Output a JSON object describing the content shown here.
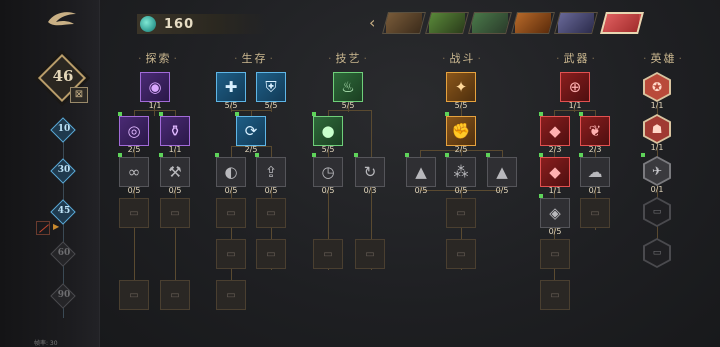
{
  "player": {
    "level": "46"
  },
  "currency": {
    "value": "160",
    "icon": "crystal-icon",
    "color": "#5fd2c0"
  },
  "milestones": [
    {
      "label": "10",
      "reached": true
    },
    {
      "label": "30",
      "reached": true
    },
    {
      "label": "45",
      "reached": true
    },
    {
      "label": "60",
      "reached": false
    },
    {
      "label": "90",
      "reached": false
    }
  ],
  "footer": {
    "text": "帧率: 30"
  },
  "categories": {
    "explore": "探索",
    "survive": "生存",
    "skill": "技艺",
    "combat": "战斗",
    "weapon": "武器",
    "hero": "英雄"
  },
  "characters": [
    {
      "name": "raccoon",
      "color": "#7a5c3a"
    },
    {
      "name": "turtle",
      "color": "#5a8a3a"
    },
    {
      "name": "goggles",
      "color": "#4a7a4a"
    },
    {
      "name": "fox",
      "color": "#b86a2a"
    },
    {
      "name": "wolf",
      "color": "#6a6a9a"
    },
    {
      "name": "red-panda",
      "color": "#d84a4a",
      "active": true
    }
  ],
  "counts": {
    "explore": [
      "1/1",
      "2/5",
      "1/1",
      "0/5",
      "0/5"
    ],
    "survive": [
      "5/5",
      "5/5",
      "2/5",
      "0/5",
      "0/5"
    ],
    "skill": [
      "5/5",
      "5/5",
      "0/5",
      "0/3"
    ],
    "combat": [
      "5/5",
      "2/5",
      "0/5",
      "0/5",
      "0/5"
    ],
    "weapon": [
      "1/1",
      "2/3",
      "2/3",
      "1/1",
      "0/1",
      "0/5"
    ],
    "hero": [
      "1/1",
      "1/1",
      "0/1"
    ]
  },
  "colors": {
    "accent": "#c9b085",
    "unlocked": "#5ed35a",
    "milestone": "#5aa9d6"
  }
}
